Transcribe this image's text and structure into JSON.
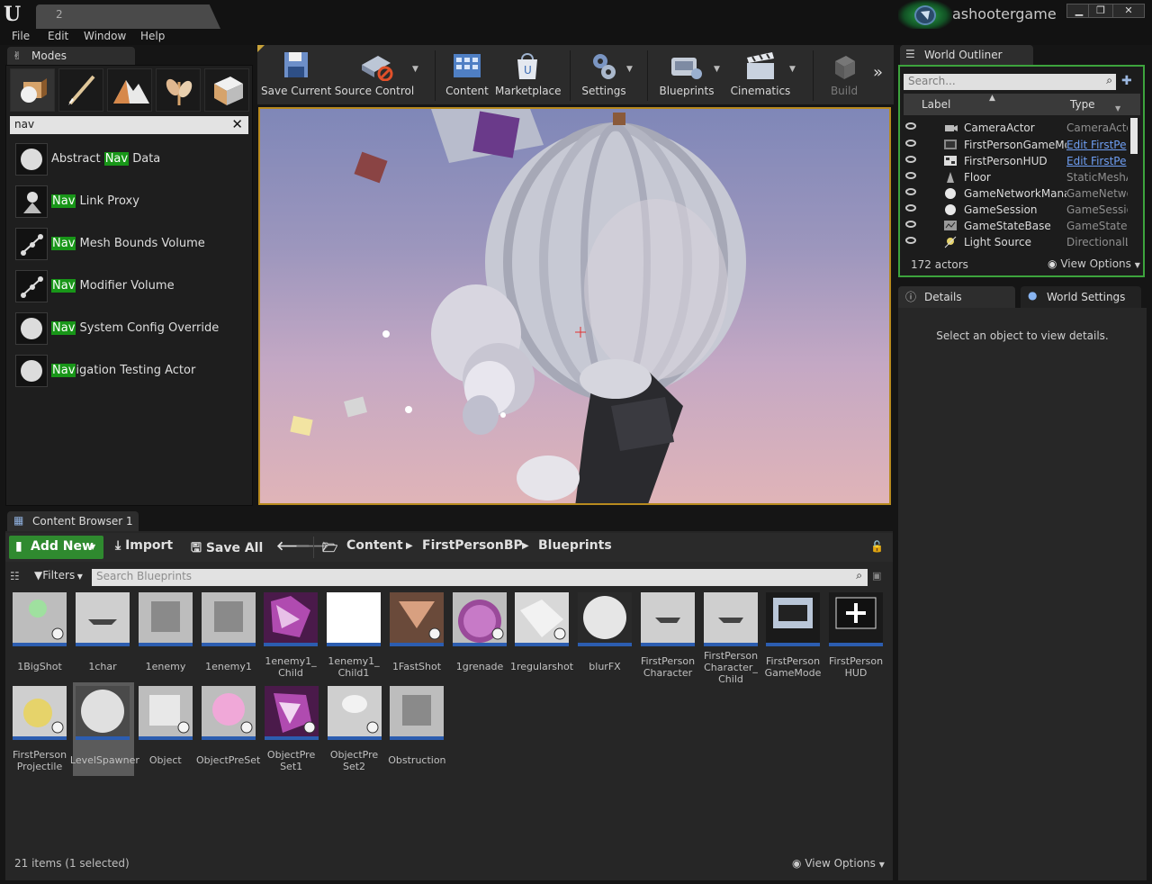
{
  "titlebar": {
    "tab_label": "2",
    "project_name": "ashootergame",
    "window_buttons": [
      "minimize",
      "restore",
      "close"
    ]
  },
  "menu": [
    "File",
    "Edit",
    "Window",
    "Help"
  ],
  "modes": {
    "tab_label": "Modes",
    "search_value": "nav",
    "items": [
      {
        "pre": "Abstract ",
        "hl": "Nav",
        "post": " Data"
      },
      {
        "pre": "",
        "hl": "Nav",
        "post": " Link Proxy"
      },
      {
        "pre": "",
        "hl": "Nav",
        "post": " Mesh Bounds Volume"
      },
      {
        "pre": "",
        "hl": "Nav",
        "post": " Modifier Volume"
      },
      {
        "pre": "",
        "hl": "Nav",
        "post": " System Config Override"
      },
      {
        "pre": "",
        "hl": "Nav",
        "post": "igation Testing Actor"
      }
    ]
  },
  "toolbar": {
    "save_current": "Save Current",
    "source_control": "Source Control",
    "content": "Content",
    "marketplace": "Marketplace",
    "settings": "Settings",
    "blueprints": "Blueprints",
    "cinematics": "Cinematics",
    "build": "Build"
  },
  "outliner": {
    "tab_label": "World Outliner",
    "search_placeholder": "Search...",
    "col_label": "Label",
    "col_type": "Type",
    "rows": [
      {
        "label": "CameraActor",
        "type": "CameraActo",
        "link": false
      },
      {
        "label": "FirstPersonGameMode",
        "type": "Edit FirstPe",
        "link": true
      },
      {
        "label": "FirstPersonHUD",
        "type": "Edit FirstPe",
        "link": true
      },
      {
        "label": "Floor",
        "type": "StaticMeshA",
        "link": false
      },
      {
        "label": "GameNetworkManager",
        "type": "GameNetwo",
        "link": false
      },
      {
        "label": "GameSession",
        "type": "GameSessio",
        "link": false
      },
      {
        "label": "GameStateBase",
        "type": "GameStateB",
        "link": false
      },
      {
        "label": "Light Source",
        "type": "DirectionalLi",
        "link": false
      }
    ],
    "actor_count": "172 actors",
    "view_options": "View Options"
  },
  "details": {
    "tab_label": "Details",
    "world_settings_label": "World Settings",
    "empty_message": "Select an object to view details."
  },
  "content_browser": {
    "tab_label": "Content Browser 1",
    "add_new": "Add New",
    "import": "Import",
    "save_all": "Save All",
    "path": [
      "Content",
      "FirstPersonBP",
      "Blueprints"
    ],
    "filters": "Filters",
    "search_placeholder": "Search Blueprints",
    "assets": [
      {
        "name": "1BigShot"
      },
      {
        "name": "1char"
      },
      {
        "name": "1enemy"
      },
      {
        "name": "1enemy1"
      },
      {
        "name": "1enemy1_\nChild"
      },
      {
        "name": "1enemy1_\nChild1"
      },
      {
        "name": "1FastShot"
      },
      {
        "name": "1grenade"
      },
      {
        "name": "1regularshot"
      },
      {
        "name": "blurFX"
      },
      {
        "name": "FirstPerson\nCharacter"
      },
      {
        "name": "FirstPerson\nCharacter_\nChild"
      },
      {
        "name": "FirstPerson\nGameMode"
      },
      {
        "name": "FirstPerson\nHUD"
      },
      {
        "name": "FirstPerson\nProjectile"
      },
      {
        "name": "LevelSpawner"
      },
      {
        "name": "Object"
      },
      {
        "name": "ObjectPreSet"
      },
      {
        "name": "ObjectPre\nSet1"
      },
      {
        "name": "ObjectPre\nSet2"
      },
      {
        "name": "Obstruction"
      }
    ],
    "status": "21 items (1 selected)",
    "view_options": "View Options"
  },
  "colors": {
    "accent_green": "#2f8a2f",
    "highlight_green": "#189618",
    "viewport_border": "#b88a1e",
    "link_blue": "#6e9ef2",
    "asset_bar_blue": "#2c5db0"
  }
}
